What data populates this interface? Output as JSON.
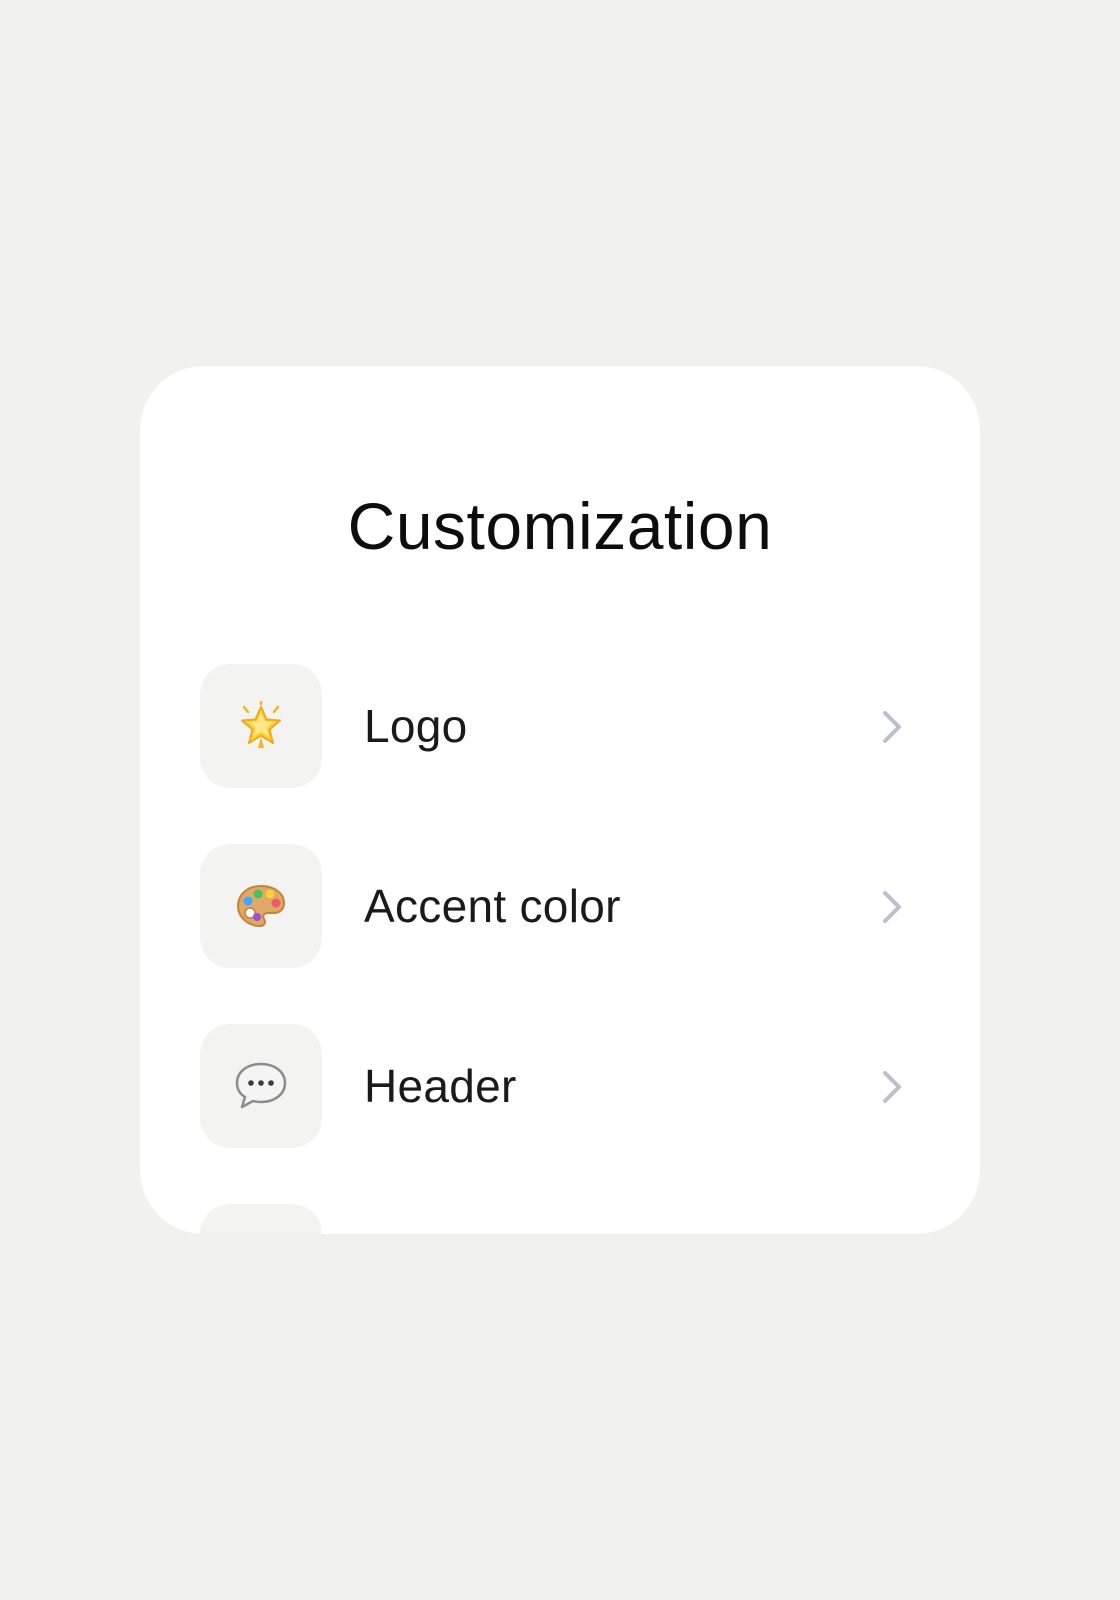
{
  "page": {
    "title": "Customization"
  },
  "menu": {
    "items": [
      {
        "label": "Logo",
        "icon": "glowing-star-icon"
      },
      {
        "label": "Accent color",
        "icon": "artist-palette-icon"
      },
      {
        "label": "Header",
        "icon": "speech-bubble-icon"
      },
      {
        "label": "",
        "icon": ""
      }
    ]
  },
  "colors": {
    "background": "#f1f1f0",
    "card": "#ffffff",
    "icon_tile": "#f3f3f2",
    "chevron": "#b9bfcc",
    "text": "#1a1a1a"
  }
}
